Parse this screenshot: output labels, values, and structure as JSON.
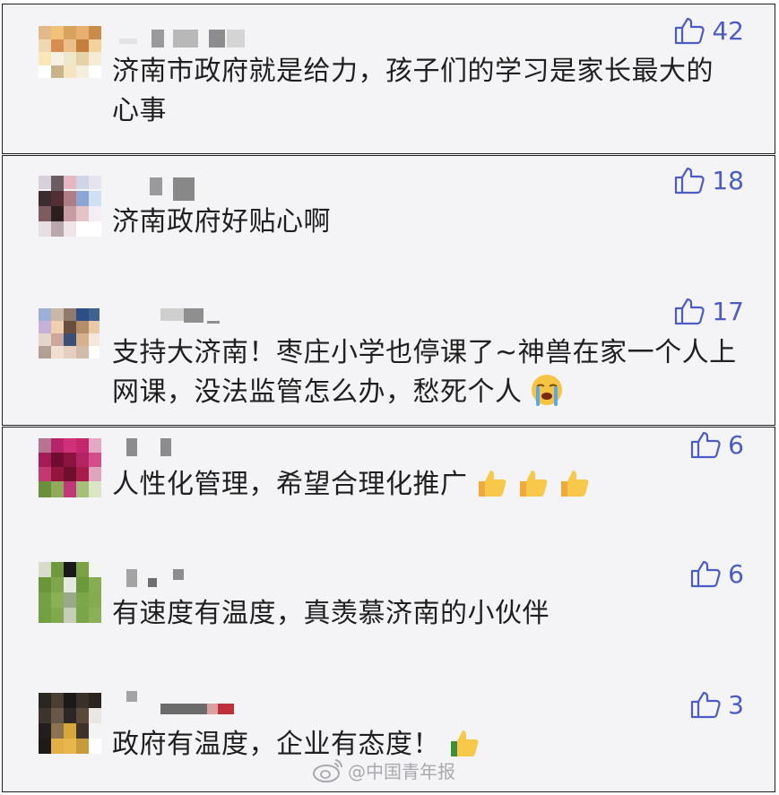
{
  "colors": {
    "accent": "#4b5cc4",
    "text": "#1f1f1f",
    "panel": "#f4f4f6",
    "watermark": "#a9a9ad"
  },
  "comments": [
    {
      "text": "济南市政府就是给力，孩子们的学习是家长最大的心事",
      "likes": "42",
      "emojis": []
    },
    {
      "text": "济南政府好贴心啊",
      "likes": "18",
      "emojis": []
    },
    {
      "text": "支持大济南！枣庄小学也停课了~神兽在家一个人上网课，没法监管怎么办，愁死个人",
      "likes": "17",
      "emojis": [
        "loudly-crying-face-icon"
      ]
    },
    {
      "text": "人性化管理，希望合理化推广",
      "likes": "6",
      "emojis": [
        "thumbs-up-icon",
        "thumbs-up-icon",
        "thumbs-up-icon"
      ]
    },
    {
      "text": "有速度有温度，真羡慕济南的小伙伴",
      "likes": "6",
      "emojis": []
    },
    {
      "text": "政府有温度，企业有态度！",
      "likes": "3",
      "emojis": [
        "thumbs-up-icon"
      ]
    }
  ],
  "watermark": {
    "text": "@中国青年报",
    "icon": "weibo-icon"
  }
}
